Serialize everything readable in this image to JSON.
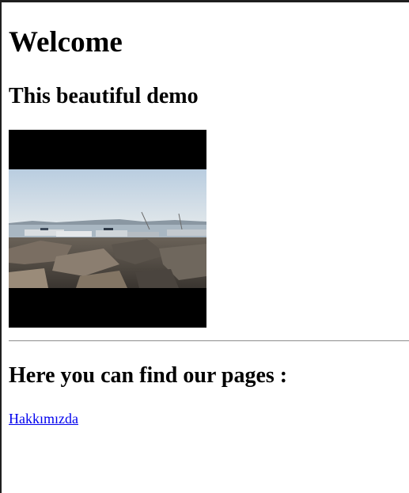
{
  "page": {
    "heading": "Welcome",
    "subheading": "This beautiful demo",
    "image": {
      "subject": "harbor-rocks-photo"
    },
    "pages_heading": "Here you can find our pages :",
    "links": [
      {
        "label": "Hakkımızda"
      }
    ]
  },
  "colors": {
    "link": "#0000ee",
    "text": "#000000",
    "background": "#ffffff",
    "divider": "#9a9a9a"
  }
}
